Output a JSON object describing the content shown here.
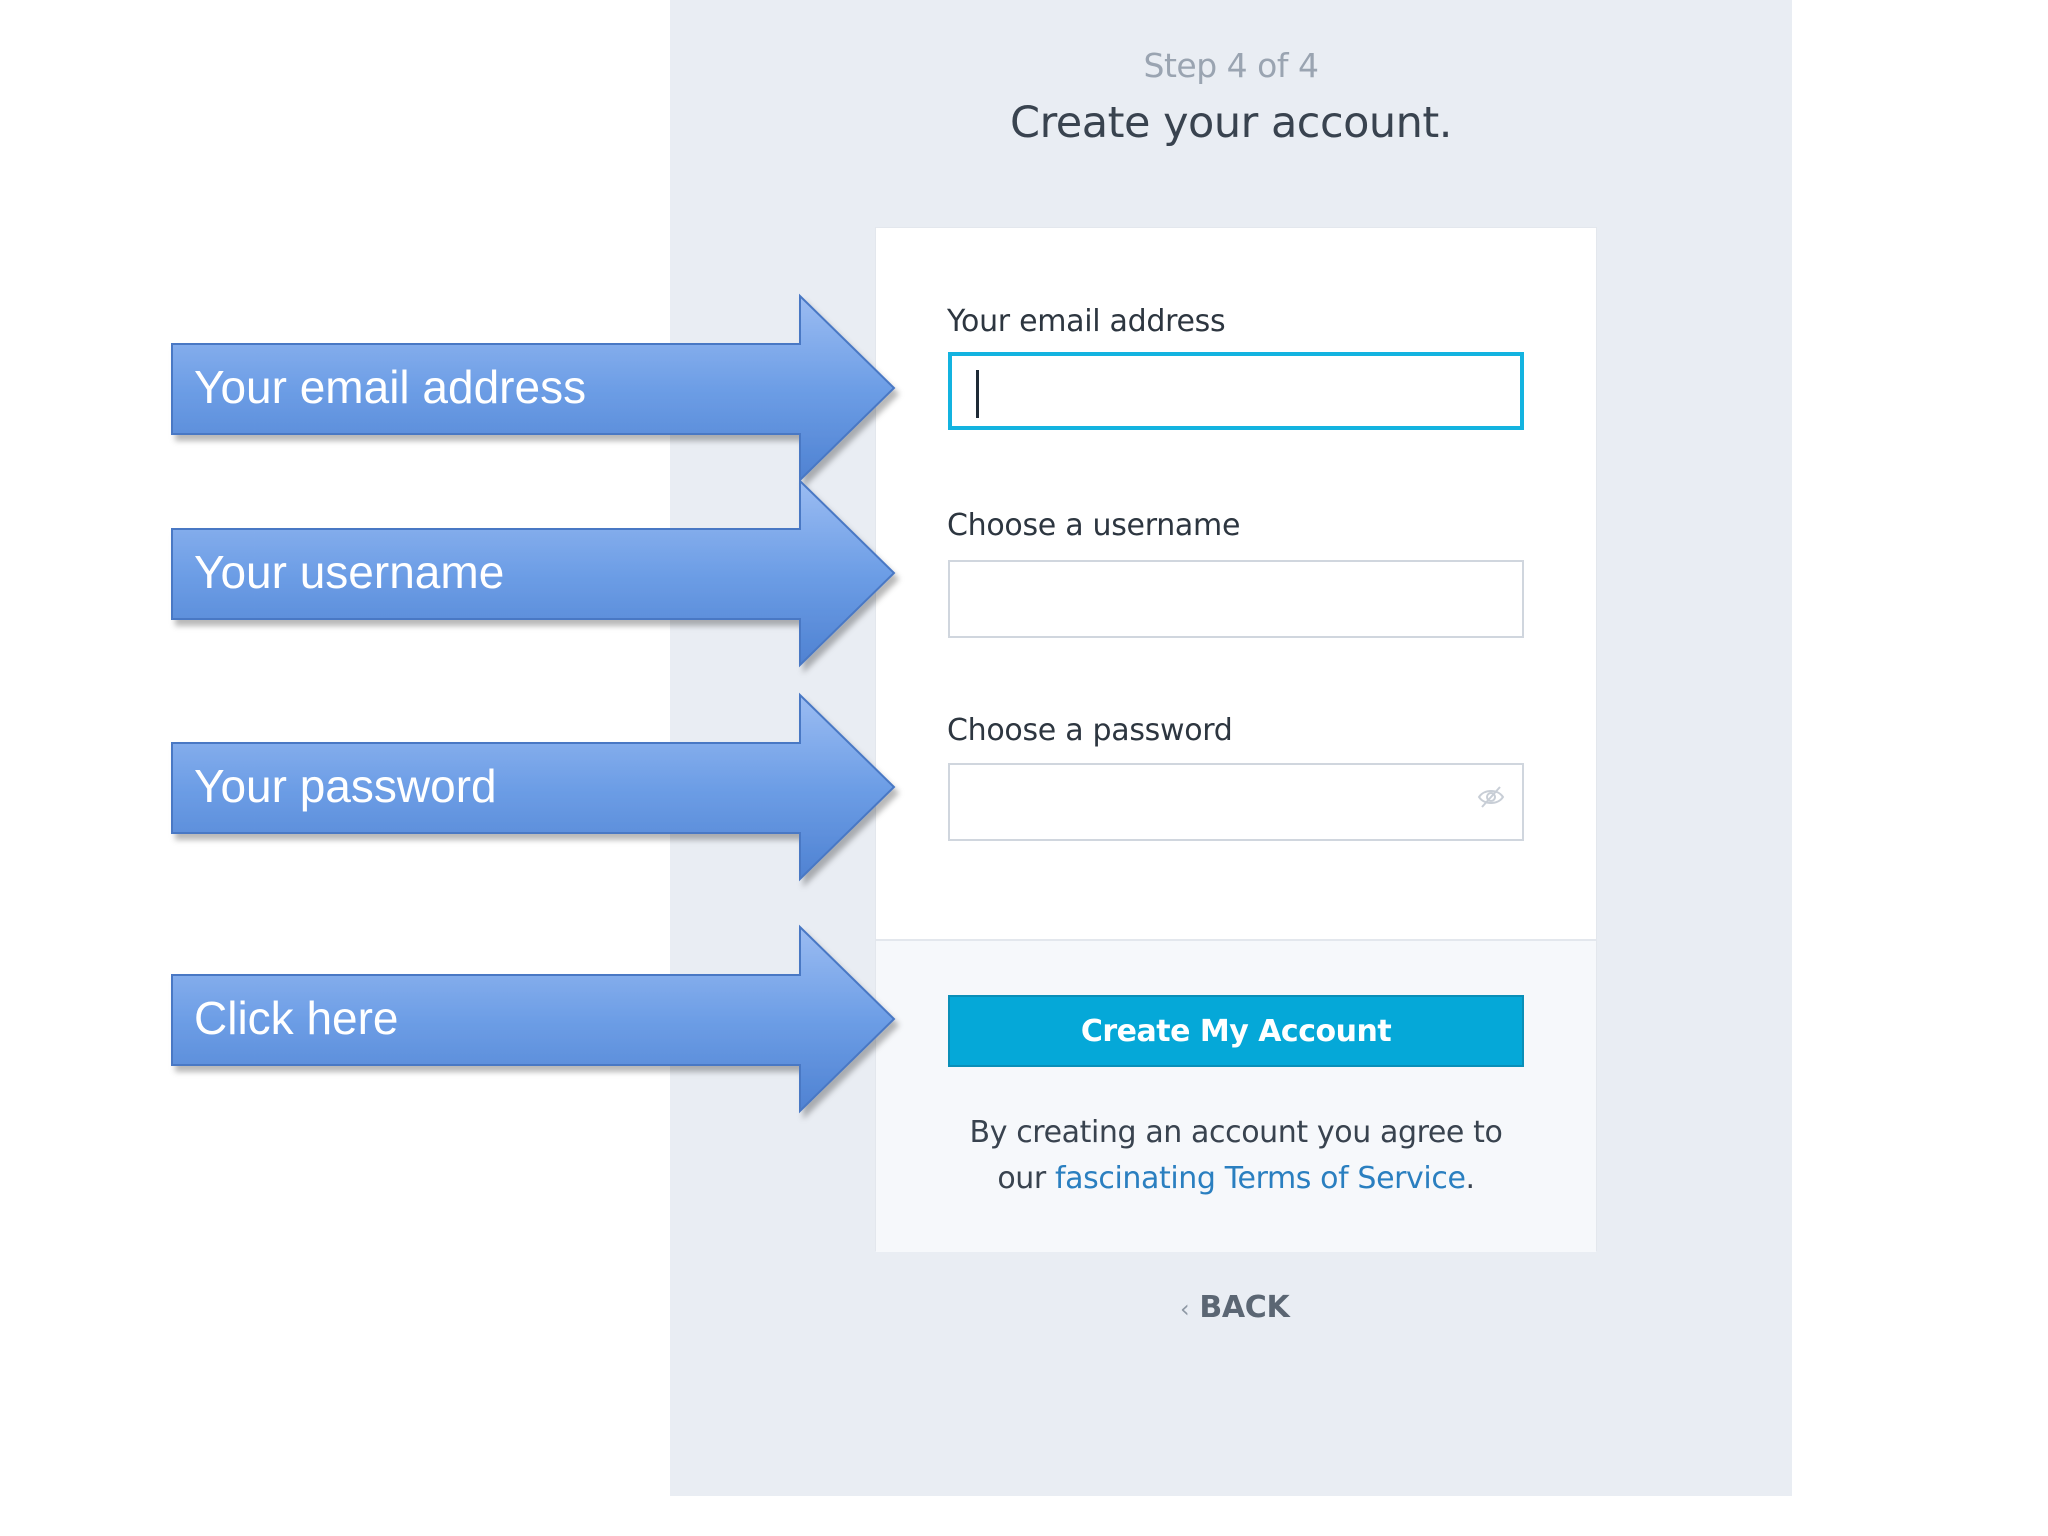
{
  "header": {
    "step": "Step 4 of 4",
    "title": "Create your account."
  },
  "form": {
    "email_label": "Your email address",
    "email_value": "",
    "username_label": "Choose a username",
    "username_value": "",
    "password_label": "Choose a password",
    "password_value": "",
    "password_toggle_icon": "eye-slash-icon",
    "submit_label": "Create My Account"
  },
  "terms": {
    "prefix": "By creating an account you agree to",
    "our": "our",
    "link": "fascinating Terms of Service",
    "suffix": "."
  },
  "back": {
    "chevron": "‹",
    "label": "BACK"
  },
  "callouts": [
    {
      "label": "Your email address"
    },
    {
      "label": "Your username"
    },
    {
      "label": "Your password"
    },
    {
      "label": "Click here"
    }
  ],
  "colors": {
    "accent": "#05a8d8",
    "panel_bg": "#e9edf3",
    "link": "#2a7fc0",
    "callout_arrow": "#6d9ee6"
  }
}
